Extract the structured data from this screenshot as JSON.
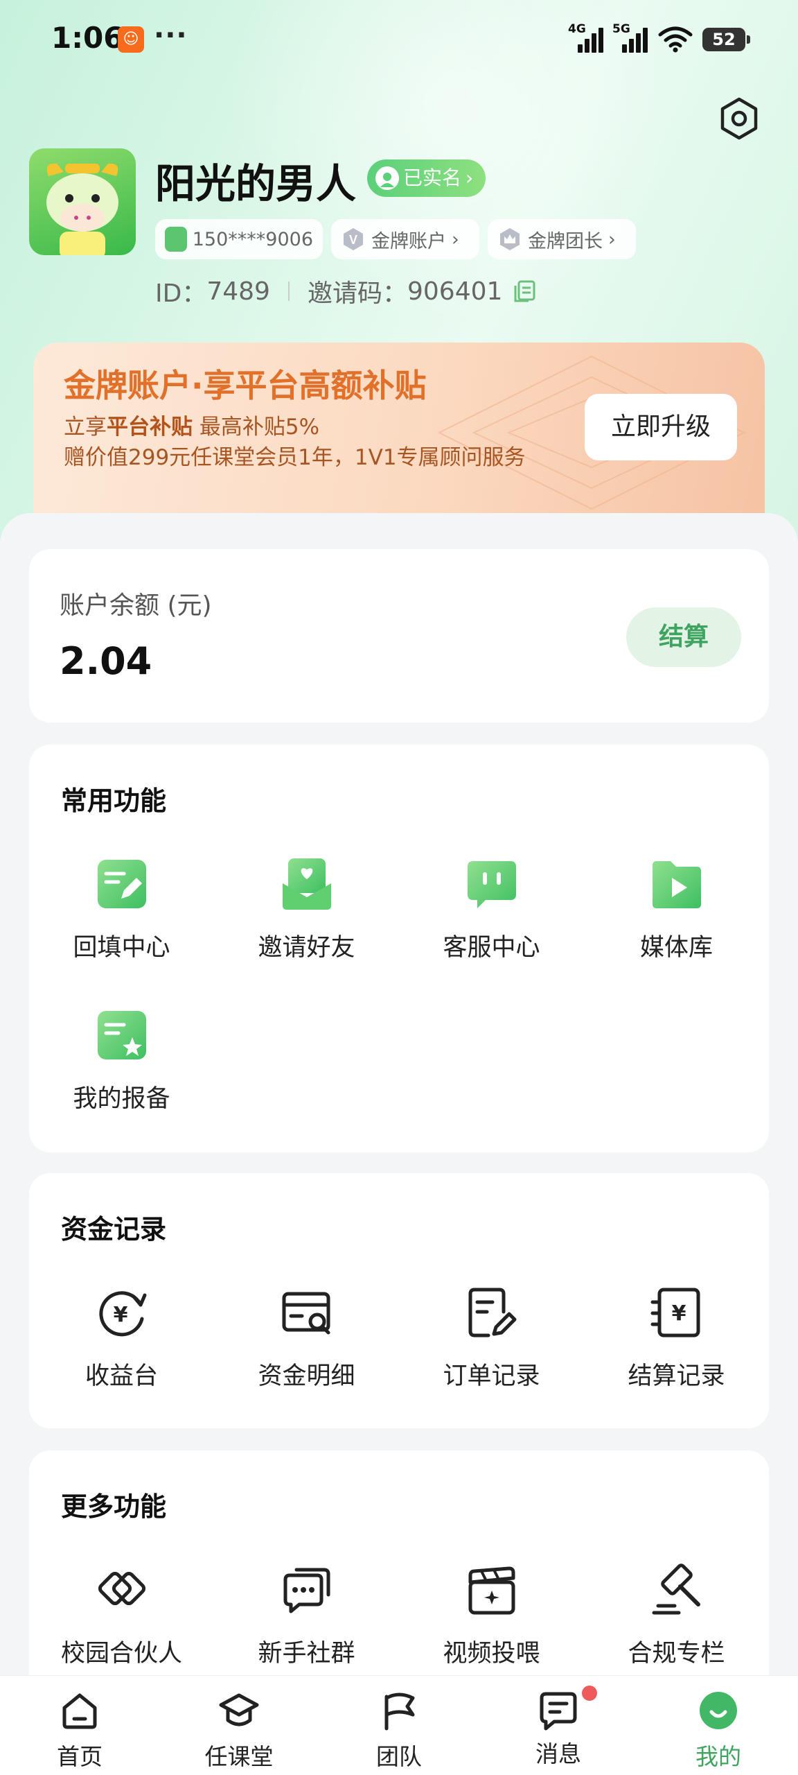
{
  "status_bar": {
    "time": "1:06",
    "app_badge_icon": "xiaohongshu-app-icon",
    "more": "···",
    "signal1": "4G",
    "signal2": "5G",
    "battery": "52"
  },
  "profile": {
    "name": "阳光的男人",
    "verified_label": "已实名",
    "phone": "150****9006",
    "account_tag": "金牌账户",
    "leader_tag": "金牌团长",
    "id_label": "ID：",
    "id_value": "7489",
    "invite_label": "邀请码：",
    "invite_value": "906401"
  },
  "promo": {
    "title": "金牌账户·享平台高额补贴",
    "sub1_a": "立享",
    "sub1_b": "平台补贴",
    "sub1_c": " 最高补贴5%",
    "sub2": "赠价值299元任课堂会员1年，1V1专属顾问服务",
    "button": "立即升级"
  },
  "balance": {
    "label": "账户余额 (元)",
    "value": "2.04",
    "button": "结算"
  },
  "common": {
    "title": "常用功能",
    "items": [
      {
        "label": "回填中心",
        "icon": "edit-doc-icon"
      },
      {
        "label": "邀请好友",
        "icon": "invite-envelope-icon"
      },
      {
        "label": "客服中心",
        "icon": "chat-service-icon"
      },
      {
        "label": "媒体库",
        "icon": "media-folder-icon"
      },
      {
        "label": "我的报备",
        "icon": "starred-doc-icon"
      }
    ]
  },
  "funds": {
    "title": "资金记录",
    "items": [
      {
        "label": "收益台",
        "icon": "yen-refresh-icon"
      },
      {
        "label": "资金明细",
        "icon": "card-search-icon"
      },
      {
        "label": "订单记录",
        "icon": "order-edit-icon"
      },
      {
        "label": "结算记录",
        "icon": "yen-receipt-icon"
      }
    ]
  },
  "more": {
    "title": "更多功能",
    "items": [
      {
        "label": "校园合伙人",
        "icon": "handshake-icon"
      },
      {
        "label": "新手社群",
        "icon": "chat-group-icon"
      },
      {
        "label": "视频投喂",
        "icon": "clapper-icon"
      },
      {
        "label": "合规专栏",
        "icon": "gavel-icon"
      }
    ]
  },
  "nav": {
    "items": [
      {
        "label": "首页",
        "icon": "home-icon"
      },
      {
        "label": "任课堂",
        "icon": "graduation-cap-icon"
      },
      {
        "label": "团队",
        "icon": "flag-icon"
      },
      {
        "label": "消息",
        "icon": "message-icon"
      },
      {
        "label": "我的",
        "icon": "smile-profile-icon"
      }
    ],
    "active_color": "#3ea45f"
  },
  "colors": {
    "accent_green": "#3ea45f",
    "promo_orange": "#e0702a"
  }
}
